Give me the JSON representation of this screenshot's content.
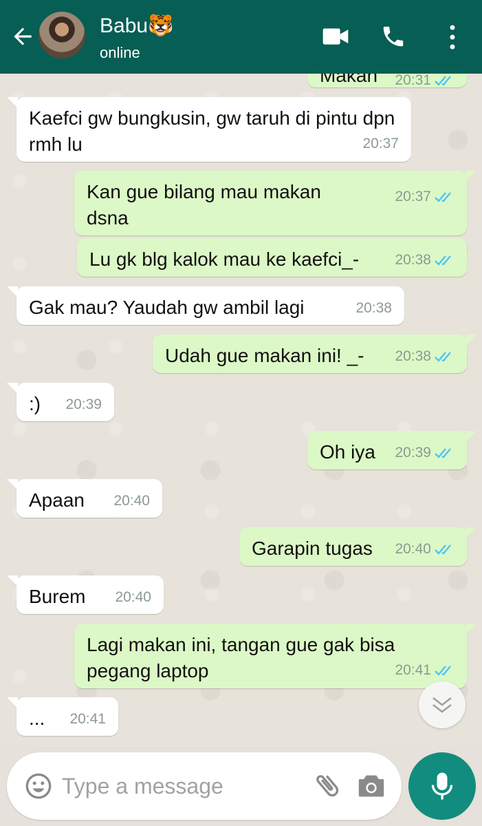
{
  "header": {
    "contact_name": "Babu🐯",
    "status": "online"
  },
  "messages": [
    {
      "dir": "out",
      "text": "Makan",
      "time": "20:31",
      "read": true,
      "partial": true
    },
    {
      "dir": "in",
      "text": "Kaefci gw bungkusin, gw taruh di pintu dpn rmh lu",
      "time": "20:37"
    },
    {
      "dir": "out",
      "text": "Kan gue bilang mau makan dsna",
      "time": "20:37",
      "read": true
    },
    {
      "dir": "out",
      "text": "Lu gk blg kalok mau ke kaefci_-",
      "time": "20:38",
      "read": true
    },
    {
      "dir": "in",
      "text": "Gak mau? Yaudah gw ambil lagi",
      "time": "20:38"
    },
    {
      "dir": "out",
      "text": "Udah gue makan ini! _-",
      "time": "20:38",
      "read": true
    },
    {
      "dir": "in",
      "text": ":)",
      "time": "20:39"
    },
    {
      "dir": "out",
      "text": "Oh iya",
      "time": "20:39",
      "read": true
    },
    {
      "dir": "in",
      "text": "Apaan",
      "time": "20:40"
    },
    {
      "dir": "out",
      "text": "Garapin tugas",
      "time": "20:40",
      "read": true
    },
    {
      "dir": "in",
      "text": "Burem",
      "time": "20:40"
    },
    {
      "dir": "out",
      "text": "Lagi makan ini, tangan gue gak bisa pegang laptop",
      "time": "20:41",
      "read": true
    },
    {
      "dir": "in",
      "text": "...",
      "time": "20:41"
    }
  ],
  "composer": {
    "placeholder": "Type a message"
  },
  "colors": {
    "header": "#075e54",
    "outgoing_bubble": "#dcf8c6",
    "incoming_bubble": "#ffffff",
    "read_ticks": "#4fc3f7",
    "mic_button": "#128c7e"
  },
  "icons": [
    "back-arrow-icon",
    "video-call-icon",
    "phone-icon",
    "more-vert-icon",
    "double-check-icon",
    "chevron-down-icon",
    "emoji-icon",
    "attach-icon",
    "camera-icon",
    "mic-icon"
  ]
}
